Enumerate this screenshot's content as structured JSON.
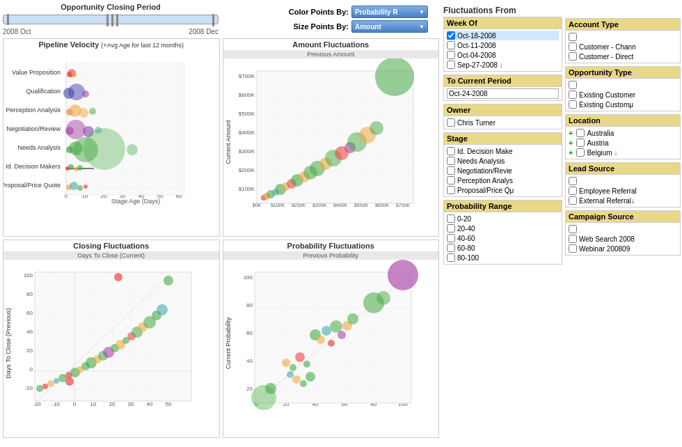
{
  "header": {
    "slider_title": "Opportunity Closing Period",
    "slider_start": "2008 Oct",
    "slider_end": "2008 Dec",
    "color_label": "Color Points By:",
    "color_value": "Probability R",
    "size_label": "Size Points By:",
    "size_value": "Amount",
    "fluctuations_title": "Fluctuations From"
  },
  "charts": {
    "pipeline": {
      "title": "Pipeline Velocity",
      "subtitle": "(+Avg Age for last 12 months)",
      "x_label": "Stage Age (Days)",
      "x_axis": [
        "0",
        "10",
        "20",
        "30",
        "40",
        "50",
        "60"
      ],
      "stages": [
        "Value Proposition",
        "Qualification",
        "Perception Analysis",
        "Negotiation/Review",
        "Needs Analysis",
        "Id. Decision Makers",
        "Proposal/Price Quote"
      ]
    },
    "amount": {
      "title": "Amount Fluctuations",
      "subtitle": "Previous Amount",
      "y_label": "Current Amount",
      "y_axis": [
        "$700K",
        "$600K",
        "$500K",
        "$400K",
        "$300K",
        "$200K",
        "$100K"
      ],
      "x_axis": [
        "$0K",
        "$100K",
        "$200K",
        "$300K",
        "$400K",
        "$500K",
        "$600K",
        "$700K"
      ]
    },
    "closing": {
      "title": "Closing Fluctuations",
      "subtitle": "Days To Close (Current)",
      "y_label": "Days To Close (Previous)",
      "y_axis": [
        "100",
        "80",
        "60",
        "40",
        "20",
        "0",
        "-20"
      ],
      "x_axis": [
        "-20",
        "-10",
        "0",
        "10",
        "20",
        "30",
        "40",
        "50"
      ]
    },
    "probability": {
      "title": "Probability Fluctuations",
      "subtitle": "Previous Probability",
      "y_label": "Current Probability",
      "y_axis": [
        "100",
        "80",
        "60",
        "40",
        "20"
      ],
      "x_axis": [
        "0",
        "20",
        "40",
        "60",
        "80",
        "100"
      ]
    }
  },
  "filters": {
    "week_of": {
      "label": "Week Of",
      "items": [
        {
          "text": "Oct-18-2008",
          "checked": true
        },
        {
          "text": "Oct-11-2008",
          "checked": false
        },
        {
          "text": "Oct-04-2008",
          "checked": false
        },
        {
          "text": "Sep-27-2008",
          "checked": false
        }
      ]
    },
    "to_current": {
      "label": "To Current Period",
      "value": "Oct-24-2008"
    },
    "owner": {
      "label": "Owner",
      "items": [
        {
          "text": "Chris Turner",
          "checked": false
        }
      ]
    },
    "stage": {
      "label": "Stage",
      "items": [
        {
          "text": "Id. Decision Make",
          "checked": false
        },
        {
          "text": "Needs Analysis",
          "checked": false
        },
        {
          "text": "Negotiation/Revie",
          "checked": false
        },
        {
          "text": "Perception Analys",
          "checked": false
        },
        {
          "text": "Proposal/Price Qμ",
          "checked": false
        }
      ]
    },
    "probability_range": {
      "label": "Probability Range",
      "items": [
        {
          "text": "0-20",
          "checked": false
        },
        {
          "text": "20-40",
          "checked": false
        },
        {
          "text": "40-60",
          "checked": false
        },
        {
          "text": "60-80",
          "checked": false
        },
        {
          "text": "80-100",
          "checked": false
        }
      ]
    },
    "account_type": {
      "label": "Account Type",
      "items": [
        {
          "text": "",
          "checked": false
        },
        {
          "text": "Customer - Chann",
          "checked": false
        },
        {
          "text": "Customer - Direct",
          "checked": false
        }
      ]
    },
    "opportunity_type": {
      "label": "Opportunity Type",
      "items": [
        {
          "text": "",
          "checked": false
        },
        {
          "text": "Existing Customer",
          "checked": false
        },
        {
          "text": "Existing Customμ",
          "checked": false
        }
      ]
    },
    "location": {
      "label": "Location",
      "items": [
        {
          "text": "Australia",
          "checked": false,
          "has_plus": true
        },
        {
          "text": "Austria",
          "checked": false,
          "has_plus": true
        },
        {
          "text": "Belgium",
          "checked": false,
          "has_plus": true
        }
      ]
    },
    "lead_source": {
      "label": "Lead Source",
      "items": [
        {
          "text": "",
          "checked": false
        },
        {
          "text": "Employee Referral",
          "checked": false
        },
        {
          "text": "External Referral↓",
          "checked": false
        }
      ]
    },
    "campaign_source": {
      "label": "Campaign Source",
      "items": [
        {
          "text": "",
          "checked": false
        },
        {
          "text": "Web Search 2008",
          "checked": false
        },
        {
          "text": "Webinar 200809",
          "checked": false
        }
      ]
    }
  }
}
